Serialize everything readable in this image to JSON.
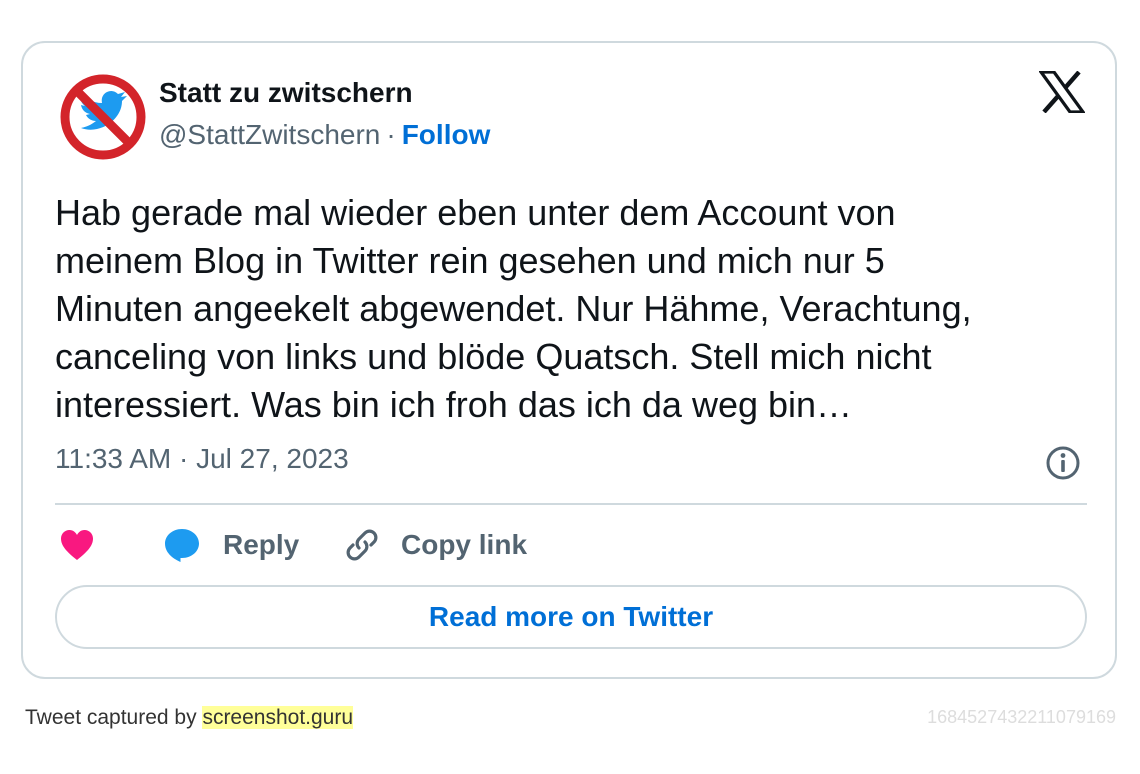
{
  "author": {
    "name": "Statt zu zwitschern",
    "handle": "@StattZwitschern",
    "separator": "·",
    "follow_label": "Follow"
  },
  "tweet": {
    "text": "Hab gerade mal wieder eben unter dem Account von\nmeinem Blog in Twitter rein gesehen und mich nur 5\nMinuten angeekelt abgewendet. Nur Hähme, Verachtung,\ncanceling von links und blöde Quatsch. Stell mich nicht\ninteressiert. Was bin ich froh das ich da weg bin…",
    "timestamp": "11:33 AM · Jul 27, 2023"
  },
  "actions": {
    "reply_label": "Reply",
    "copy_link_label": "Copy link",
    "read_more_label": "Read more on Twitter"
  },
  "footer": {
    "captured_by": "Tweet captured by ",
    "site": "screenshot.guru",
    "tweet_id": "1684527432211079169"
  },
  "icons": {
    "avatar": "no-twitter-bird-icon",
    "brand": "x-logo-icon",
    "info": "info-icon",
    "like": "heart-icon",
    "reply": "speech-bubble-icon",
    "copy": "link-icon"
  },
  "colors": {
    "accent": "#006fd6",
    "heart": "#f91880",
    "reply_bubble": "#1d9bf0",
    "muted": "#536471",
    "border": "#cfd9de",
    "highlight": "#ffff99",
    "no_sign": "#d3242a"
  }
}
